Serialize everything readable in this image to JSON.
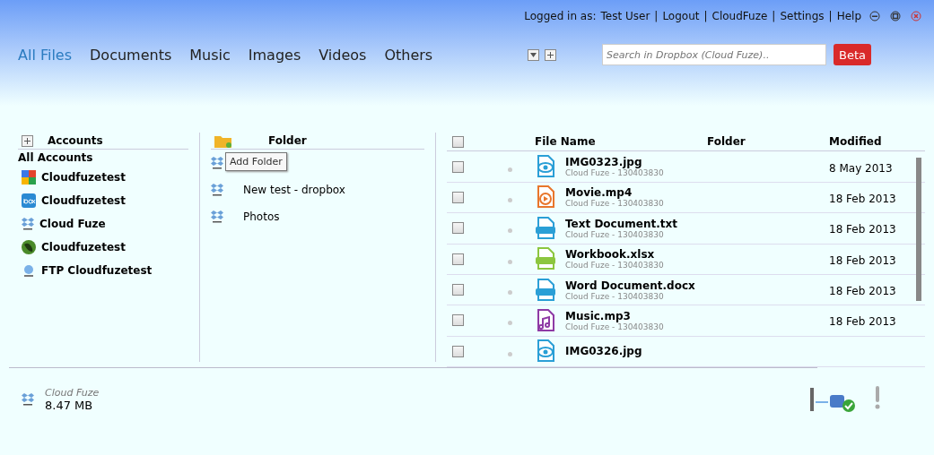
{
  "top_bar": {
    "logged_in_label": "Logged in as:",
    "user": "Test User",
    "links": [
      "Logout",
      "CloudFuze",
      "Settings",
      "Help"
    ],
    "separator": "|"
  },
  "tabs": [
    {
      "label": "All Files",
      "selected": true
    },
    {
      "label": "Documents",
      "selected": false
    },
    {
      "label": "Music",
      "selected": false
    },
    {
      "label": "Images",
      "selected": false
    },
    {
      "label": "Videos",
      "selected": false
    },
    {
      "label": "Others",
      "selected": false
    }
  ],
  "search": {
    "placeholder": "Search in Dropbox (Cloud Fuze).."
  },
  "beta_button": "Beta",
  "accounts": {
    "title": "Accounts",
    "all_label": "All Accounts",
    "items": [
      {
        "name": "Cloudfuzetest",
        "kind": "google"
      },
      {
        "name": "Cloudfuzetest",
        "kind": "box"
      },
      {
        "name": "Cloud Fuze",
        "kind": "dropbox"
      },
      {
        "name": "Cloudfuzetest",
        "kind": "globe"
      },
      {
        "name": "FTP Cloudfuzetest",
        "kind": "ftp"
      }
    ]
  },
  "folders": {
    "title": "Folder",
    "tooltip": "Add Folder",
    "items": [
      {
        "kind": "covered"
      },
      {
        "kind": "folder",
        "name": "New test - dropbox"
      },
      {
        "kind": "folder",
        "name": "Photos"
      }
    ]
  },
  "files": {
    "columns": [
      "File Name",
      "Folder",
      "Modified"
    ],
    "select_all_checked": false,
    "rows": [
      {
        "name": "IMG0323.jpg",
        "source": "Cloud Fuze - 130403830",
        "modified": "8 May 2013",
        "kind": "image",
        "checked": false
      },
      {
        "name": "Movie.mp4",
        "source": "Cloud Fuze - 130403830",
        "modified": "18 Feb 2013",
        "kind": "video",
        "checked": false
      },
      {
        "name": "Text Document.txt",
        "source": "Cloud Fuze - 130403830",
        "modified": "18 Feb 2013",
        "kind": "doc",
        "checked": false
      },
      {
        "name": "Workbook.xlsx",
        "source": "Cloud Fuze - 130403830",
        "modified": "18 Feb 2013",
        "kind": "xls",
        "checked": false
      },
      {
        "name": "Word Document.docx",
        "source": "Cloud Fuze - 130403830",
        "modified": "18 Feb 2013",
        "kind": "doc",
        "checked": false
      },
      {
        "name": "Music.mp3",
        "source": "Cloud Fuze - 130403830",
        "modified": "18 Feb 2013",
        "kind": "audio",
        "checked": false
      },
      {
        "name": "IMG0326.jpg",
        "kind": "image",
        "checked": false
      }
    ]
  },
  "storage": {
    "account": "Cloud Fuze",
    "size": "8.47 MB"
  }
}
